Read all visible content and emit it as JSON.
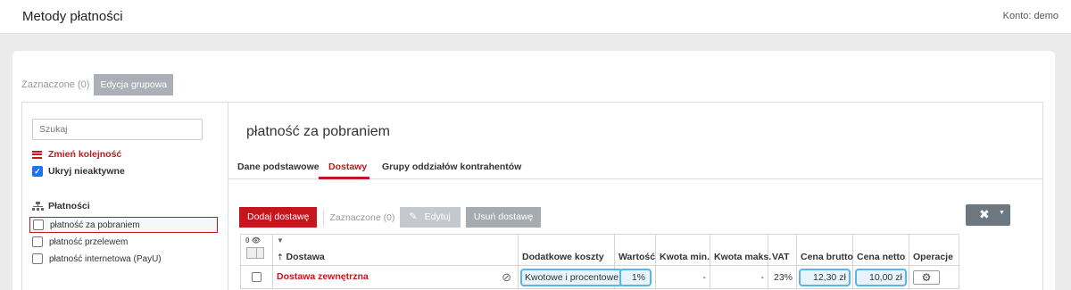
{
  "header": {
    "title": "Metody płatności",
    "account": "Konto: demo"
  },
  "group_bar": {
    "selected": "Zaznaczone (0)",
    "group_edit": "Edycja grupowa"
  },
  "sidebar": {
    "search_placeholder": "Szukaj",
    "reorder_label": "Zmień kolejność",
    "hide_inactive_label": "Ukryj nieaktywne",
    "tree_root": "Płatności",
    "items": [
      {
        "label": "płatność za pobraniem",
        "active": true
      },
      {
        "label": "płatność przelewem",
        "active": false
      },
      {
        "label": "płatność internetowa (PayU)",
        "active": false
      }
    ]
  },
  "detail": {
    "title": "płatność za pobraniem",
    "tabs": [
      "Dane podstawowe",
      "Dostawy",
      "Grupy oddziałów kontrahentów"
    ],
    "active_tab": "Dostawy"
  },
  "toolbar": {
    "add": "Dodaj dostawę",
    "selected": "Zaznaczone (0)",
    "edit": "Edytuj",
    "remove": "Usuń dostawę"
  },
  "table": {
    "header_count": "0",
    "columns": [
      "Dostawa",
      "Dodatkowe koszty",
      "Wartość",
      "Kwota min.",
      "Kwota maks.",
      "VAT",
      "Cena brutto",
      "Cena netto",
      "Operacje"
    ],
    "rows": [
      {
        "name": "Dostawa zewnętrzna",
        "extra_costs": "Kwotowe i procentowe",
        "value": "1%",
        "min": "-",
        "max": "-",
        "vat": "23%",
        "gross": "12,30 zł",
        "net": "10,00 zł"
      }
    ]
  },
  "colors": {
    "accent_red": "#c4161c",
    "highlight_blue": "#5ab4e5",
    "checkbox_blue": "#1a73e8"
  }
}
